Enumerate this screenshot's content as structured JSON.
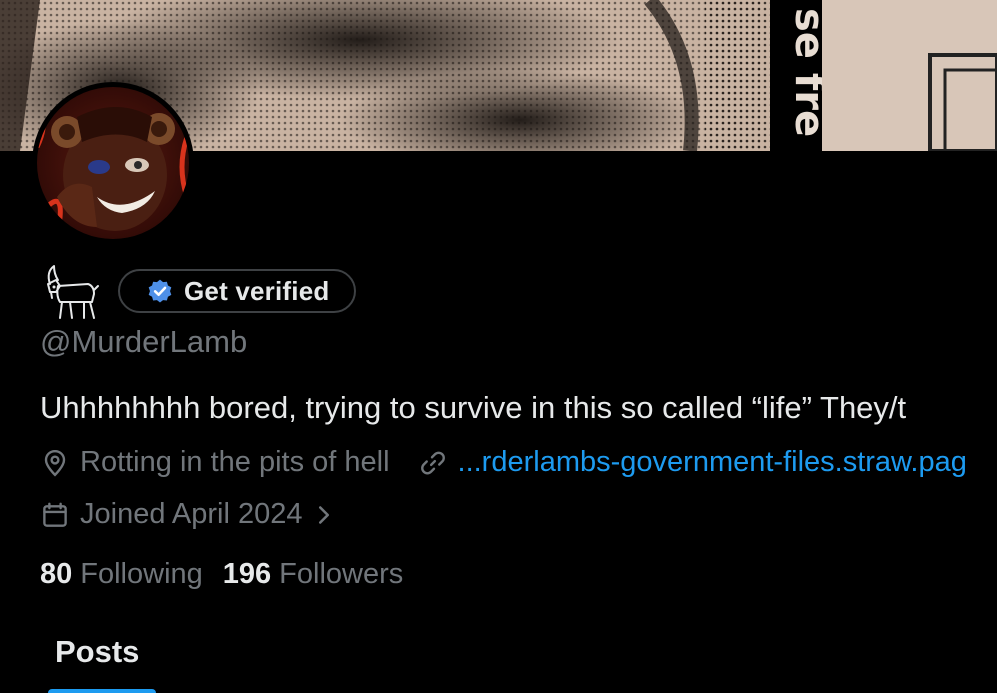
{
  "profile": {
    "verify_label": "Get verified",
    "handle": "@MurderLamb",
    "bio": "Uhhhhhhhh bored, trying to survive in this so called “life” They/t",
    "location": "Rotting in the pits of hell",
    "website": "...rderlambs-government-files.straw.pag",
    "joined": "Joined April 2024"
  },
  "banner": {
    "text": "se fre"
  },
  "stats": {
    "following_count": "80",
    "following_label": "Following",
    "followers_count": "196",
    "followers_label": "Followers"
  },
  "tabs": {
    "posts": "Posts"
  },
  "colors": {
    "background": "#000000",
    "text_primary": "#e7e9ea",
    "text_secondary": "#71767b",
    "accent": "#1d9bf0",
    "button_border": "#3e4144"
  },
  "icons": {
    "verified": "verified-badge-icon",
    "location": "location-pin-icon",
    "link": "link-icon",
    "calendar": "calendar-icon",
    "chevron": "chevron-right-icon",
    "goat": "goat-emoji-icon"
  }
}
